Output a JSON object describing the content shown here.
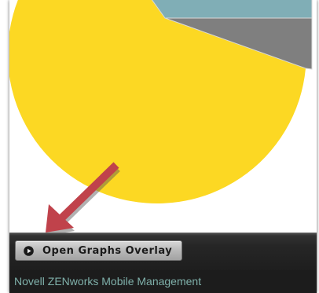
{
  "toolbar": {
    "open_graphs_overlay_label": "Open Graphs Overlay"
  },
  "footer": {
    "product_name": "Novell ZENworks Mobile Management"
  },
  "colors": {
    "pie_yellow": "#fcd823",
    "pie_gray": "#7f7f7f",
    "pie_teal": "#80aeb6",
    "arrow_red": "#c0424b",
    "footer_text": "#7fb0aa"
  },
  "icons": {
    "overlay_button_icon": "play-circle-icon",
    "annotation": "red-arrow-icon"
  }
}
